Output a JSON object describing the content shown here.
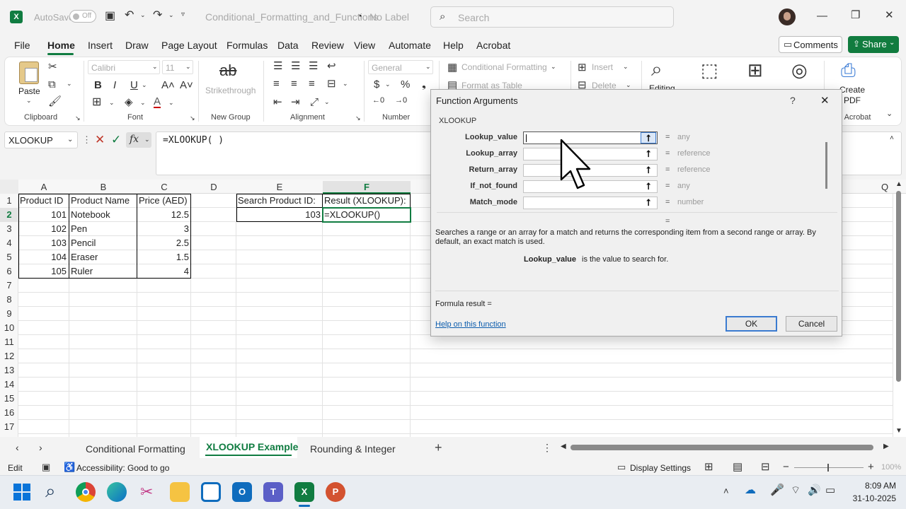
{
  "titlebar": {
    "autosave_label": "AutoSave",
    "autosave_state": "Off",
    "filename": "Conditional_Formatting_and_Functions",
    "label": "No Label",
    "search_placeholder": "Search"
  },
  "menu": {
    "items": [
      "File",
      "Home",
      "Insert",
      "Draw",
      "Page Layout",
      "Formulas",
      "Data",
      "Review",
      "View",
      "Automate",
      "Help",
      "Acrobat"
    ],
    "comments": "Comments",
    "share": "Share"
  },
  "ribbon": {
    "paste": "Paste",
    "clipboard": "Clipboard",
    "font_name": "Calibri",
    "font_size": "11",
    "font": "Font",
    "strikethrough": "Strikethrough",
    "new_group": "New Group",
    "alignment": "Alignment",
    "number_format": "General",
    "number": "Number",
    "conditional_formatting": "Conditional Formatting",
    "format_as_table": "Format as Table",
    "insert": "Insert",
    "delete": "Delete",
    "editing": "Editing",
    "create_pdf": "Create PDF",
    "acrobat": "e Acrobat"
  },
  "formula_bar": {
    "name_box": "XLOOKUP",
    "formula": "=XLOOKUP( )"
  },
  "columns": [
    "A",
    "B",
    "C",
    "D",
    "E",
    "F"
  ],
  "column_q": "Q",
  "rows": [
    "1",
    "2",
    "3",
    "4",
    "5",
    "6",
    "7",
    "8",
    "9",
    "10",
    "11",
    "12",
    "13",
    "14",
    "15",
    "16",
    "17"
  ],
  "table": {
    "headers": [
      "Product ID",
      "Product Name",
      "Price (AED)"
    ],
    "data": [
      [
        "101",
        "Notebook",
        "12.5"
      ],
      [
        "102",
        "Pen",
        "3"
      ],
      [
        "103",
        "Pencil",
        "2.5"
      ],
      [
        "104",
        "Eraser",
        "1.5"
      ],
      [
        "105",
        "Ruler",
        "4"
      ]
    ]
  },
  "search": {
    "label": "Search Product ID:",
    "value": "103",
    "result_label": "Result (XLOOKUP):",
    "result_formula": "=XLOOKUP()"
  },
  "dialog": {
    "title": "Function Arguments",
    "help_glyph": "?",
    "close_glyph": "✕",
    "function_name": "XLOOKUP",
    "args": [
      {
        "name": "Lookup_value",
        "type": "any"
      },
      {
        "name": "Lookup_array",
        "type": "reference"
      },
      {
        "name": "Return_array",
        "type": "reference"
      },
      {
        "name": "If_not_found",
        "type": "any"
      },
      {
        "name": "Match_mode",
        "type": "number"
      }
    ],
    "eq": "=",
    "description": "Searches a range or an array for a match and returns the corresponding item from a second range or array. By default, an exact match is used.",
    "arg_help_name": "Lookup_value",
    "arg_help_text": "is the value to search for.",
    "formula_result": "Formula result =",
    "help_link": "Help on this function",
    "ok": "OK",
    "cancel": "Cancel"
  },
  "sheets": [
    "Conditional Formatting",
    "XLOOKUP Example",
    "Rounding & Integer"
  ],
  "active_sheet": "XLOOKUP Example",
  "status": {
    "mode": "Edit",
    "accessibility": "Accessibility: Good to go",
    "display_settings": "Display Settings",
    "zoom": "100%"
  },
  "taskbar": {
    "time": "8:09 AM",
    "date": "31-10-2025"
  },
  "colors": {
    "excel_green": "#107c41",
    "share_green": "#117c3f",
    "active_tab": "#107c41"
  }
}
